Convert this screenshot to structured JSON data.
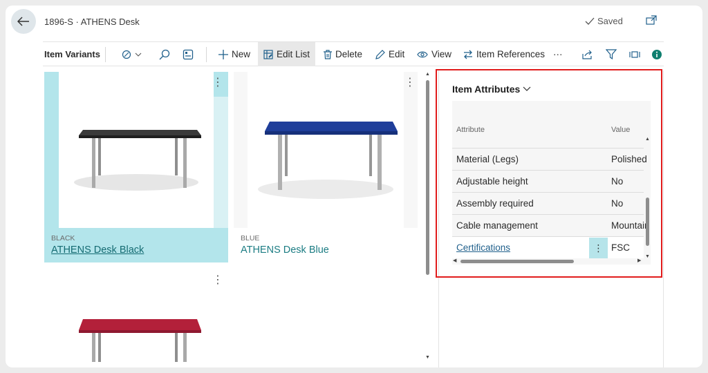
{
  "header": {
    "title": "1896-S · ATHENS Desk",
    "saved_label": "Saved"
  },
  "toolbar": {
    "section_title": "Item Variants",
    "new_label": "New",
    "edit_list_label": "Edit List",
    "delete_label": "Delete",
    "edit_label": "Edit",
    "view_label": "View",
    "item_references_label": "Item References",
    "more_label": "···"
  },
  "variants": [
    {
      "code": "BLACK",
      "name": "ATHENS Desk Black",
      "color": "#3a3a3a",
      "selected": true
    },
    {
      "code": "BLUE",
      "name": "ATHENS Desk Blue",
      "color": "#1f3e9a",
      "selected": false
    },
    {
      "code": "",
      "name": "",
      "color": "#b3203a",
      "selected": false
    }
  ],
  "attributes": {
    "title": "Item Attributes",
    "col_attribute": "Attribute",
    "col_value": "Value",
    "rows": [
      {
        "name": "Material (Legs)",
        "value": "Polished"
      },
      {
        "name": "Adjustable height",
        "value": "No"
      },
      {
        "name": "Assembly required",
        "value": "No"
      },
      {
        "name": "Cable management",
        "value": "Mountain"
      },
      {
        "name": "Certifications",
        "value": "FSC"
      }
    ]
  },
  "colors": {
    "accent": "#1b7c83",
    "selected_card": "#b3e5eb",
    "highlight_border": "#e11b1b",
    "info_icon": "#0f7f6f"
  }
}
